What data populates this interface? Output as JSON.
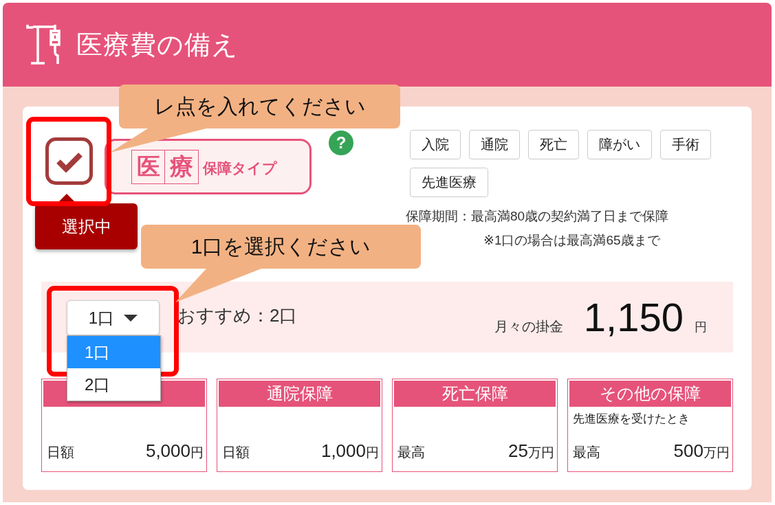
{
  "header": {
    "title": "医療費の備え"
  },
  "plan": {
    "checked": true,
    "status_tip": "選択中",
    "badge_chars": [
      "医",
      "療"
    ],
    "badge_label": "保障タイプ",
    "help": "?",
    "tags": [
      "入院",
      "通院",
      "死亡",
      "障がい",
      "手術",
      "先進医療"
    ],
    "period": "保障期間：最高満80歳の契約満了日まで保障",
    "note": "※1口の場合は最高満65歳まで"
  },
  "units": {
    "value": "1口",
    "recommend": "おすすめ：2口",
    "open": true,
    "options": [
      {
        "label": "1口",
        "selected": true
      },
      {
        "label": "2口",
        "selected": false
      }
    ]
  },
  "premium": {
    "label": "月々の掛金",
    "amount": "1,150",
    "unit": "円"
  },
  "cards": [
    {
      "label": "日額",
      "amount": "5,000",
      "unit": "円"
    },
    {
      "title": "通院保障",
      "label": "日額",
      "amount": "1,000",
      "unit": "円"
    },
    {
      "title": "死亡保障",
      "label": "最高",
      "amount": "25",
      "unit": "万円"
    },
    {
      "title": "その他の保障",
      "note": "先進医療を受けたとき",
      "label": "最高",
      "amount": "500",
      "unit": "万円"
    }
  ],
  "callouts": [
    {
      "text": "レ点を入れてください"
    },
    {
      "text": "1口を選択ください"
    }
  ]
}
